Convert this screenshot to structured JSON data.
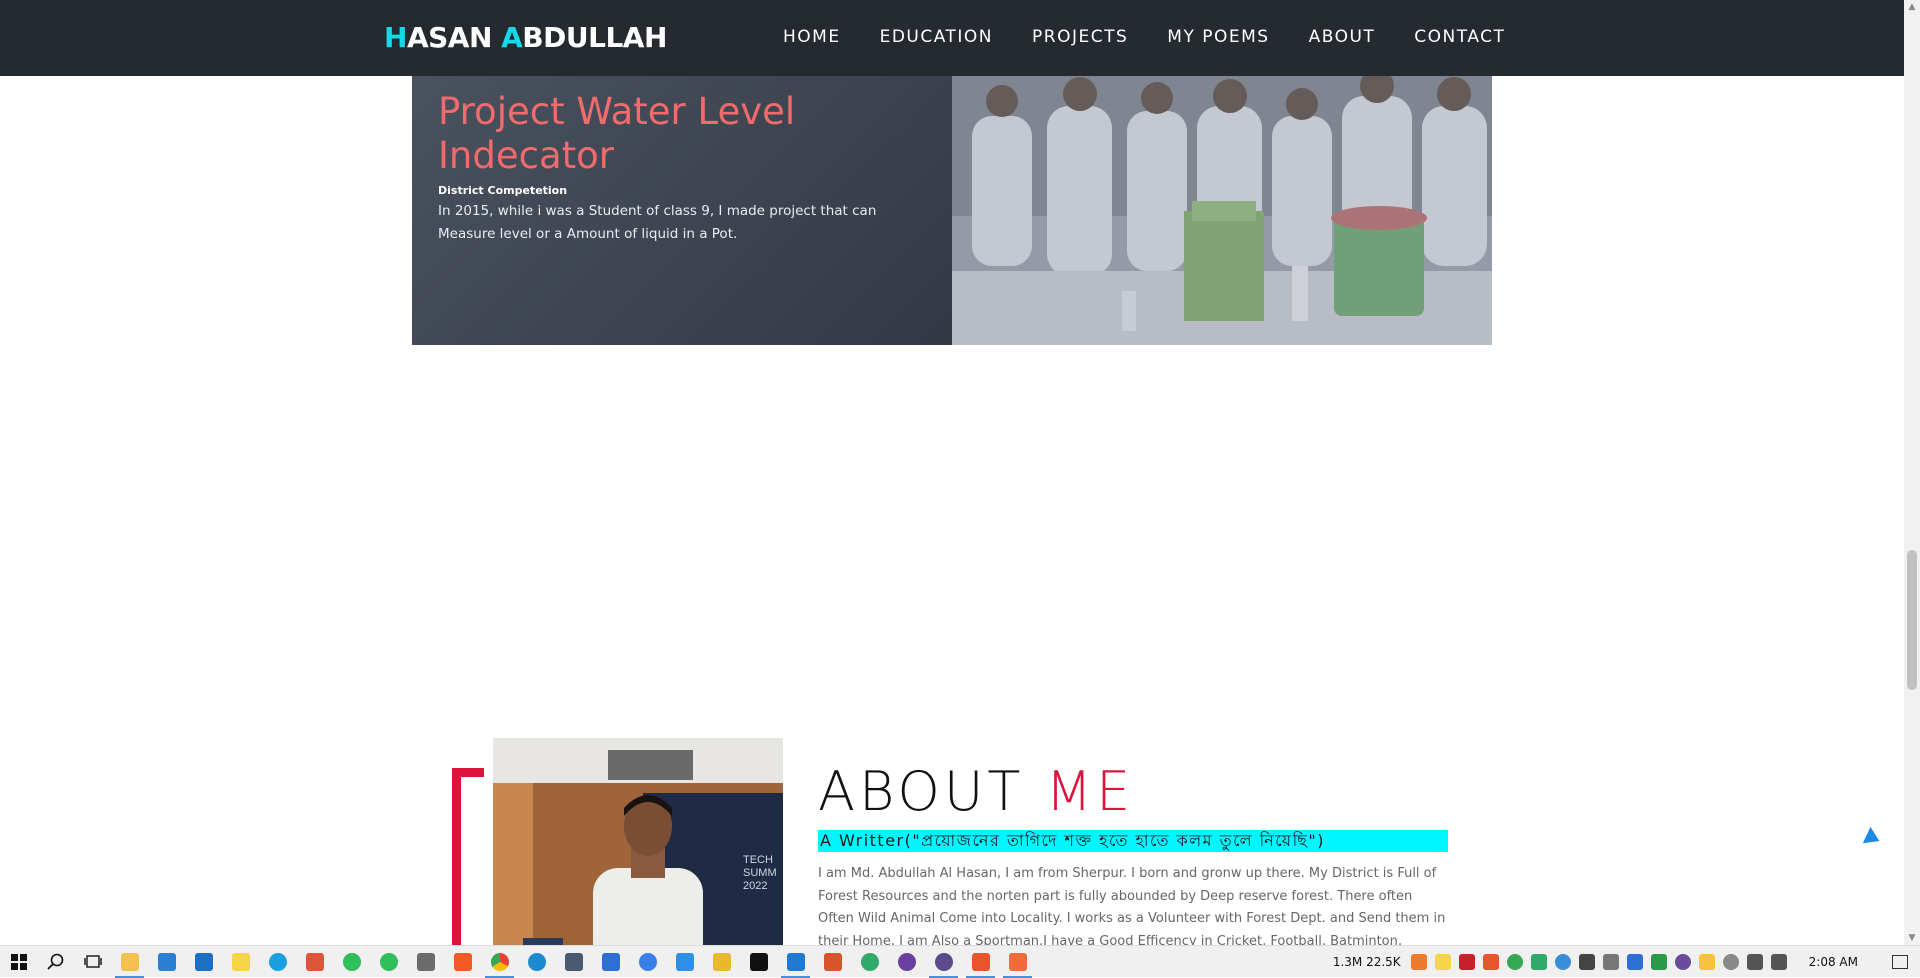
{
  "brand": {
    "first_initial": "H",
    "first_rest": "ASAN ",
    "last_initial": "A",
    "last_rest": "BDULLAH"
  },
  "nav": [
    "HOME",
    "EDUCATION",
    "PROJECTS",
    "MY POEMS",
    "ABOUT",
    "CONTACT"
  ],
  "project": {
    "title": "Project Water Level Indecator",
    "subtitle": "District Competetion",
    "description": "In 2015, while i was a Student of class 9, I made project that can Measure level or a Amount of liquid in a Pot."
  },
  "about": {
    "heading_main": "ABOUT ",
    "heading_accent": "ME",
    "tagline": "A Writter(\"প্রয়োজনের তাগিদে শক্ত হতে হাতে কলম তুলে নিয়েছি\")",
    "body": "I am Md. Abdullah Al Hasan, I am from Sherpur. I born and gronw up there. My District is Full of Forest Resources and the norten part is fully abounded by Deep reserve forest. There often Often Wild Animal Come into Locality. I works as a Volunteer with Forest Dept. and Send them in their Home. I am Also a Sportman.I have a Good Efficency in Cricket, Football, Batminton,"
  },
  "taskbar": {
    "network_speed": "1.3M 22.5K",
    "clock": "2:08 AM"
  },
  "colors": {
    "nav_bg": "#252a31",
    "brand_accent": "#14d9e8",
    "project_title": "#f06b6b",
    "about_accent": "#dc143c",
    "tagline_bg": "#00f7ff"
  },
  "icons": [
    "windows-start-icon",
    "search-icon",
    "task-view-icon",
    "file-explorer-icon",
    "store-icon",
    "mail-icon",
    "sticky-notes-icon",
    "skype-icon",
    "app-icon",
    "whatsapp-icon",
    "whatsapp-icon",
    "calculator-icon",
    "brave-icon",
    "chrome-icon",
    "edge-icon",
    "camera-icon",
    "app-icon",
    "itunes-icon",
    "app-icon",
    "app-icon",
    "pycharm-icon",
    "vscode-icon",
    "app-icon",
    "app-icon",
    "github-icon",
    "eclipse-icon",
    "brave-icon",
    "brave-icon"
  ]
}
